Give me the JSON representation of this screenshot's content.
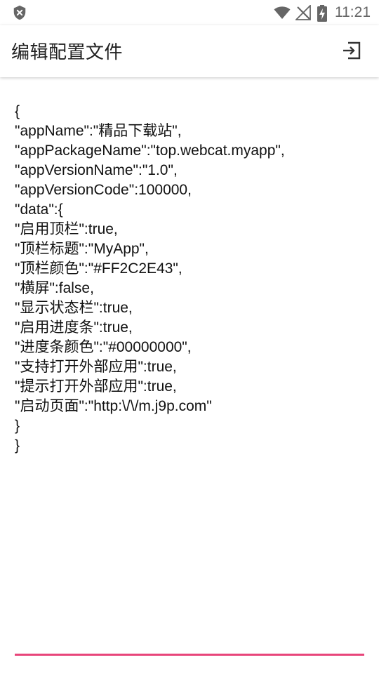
{
  "status_bar": {
    "time": "11:21",
    "icons": [
      "shield-icon",
      "wifi-icon",
      "no-signal-icon",
      "battery-charging-icon"
    ]
  },
  "app_bar": {
    "title": "编辑配置文件",
    "action_icon": "sign-in-icon"
  },
  "editor": {
    "content": "{\n\"appName\":\"精品下载站\",\n\"appPackageName\":\"top.webcat.myapp\",\n\"appVersionName\":\"1.0\",\n\"appVersionCode\":100000,\n\"data\":{\n\"启用顶栏\":true,\n\"顶栏标题\":\"MyApp\",\n\"顶栏颜色\":\"#FF2C2E43\",\n\"横屏\":false,\n\"显示状态栏\":true,\n\"启用进度条\":true,\n\"进度条颜色\":\"#00000000\",\n\"支持打开外部应用\":true,\n\"提示打开外部应用\":true,\n\"启动页面\":\"http:\\/\\/m.j9p.com\"\n}\n}",
    "accent_color": "#e8457a"
  }
}
